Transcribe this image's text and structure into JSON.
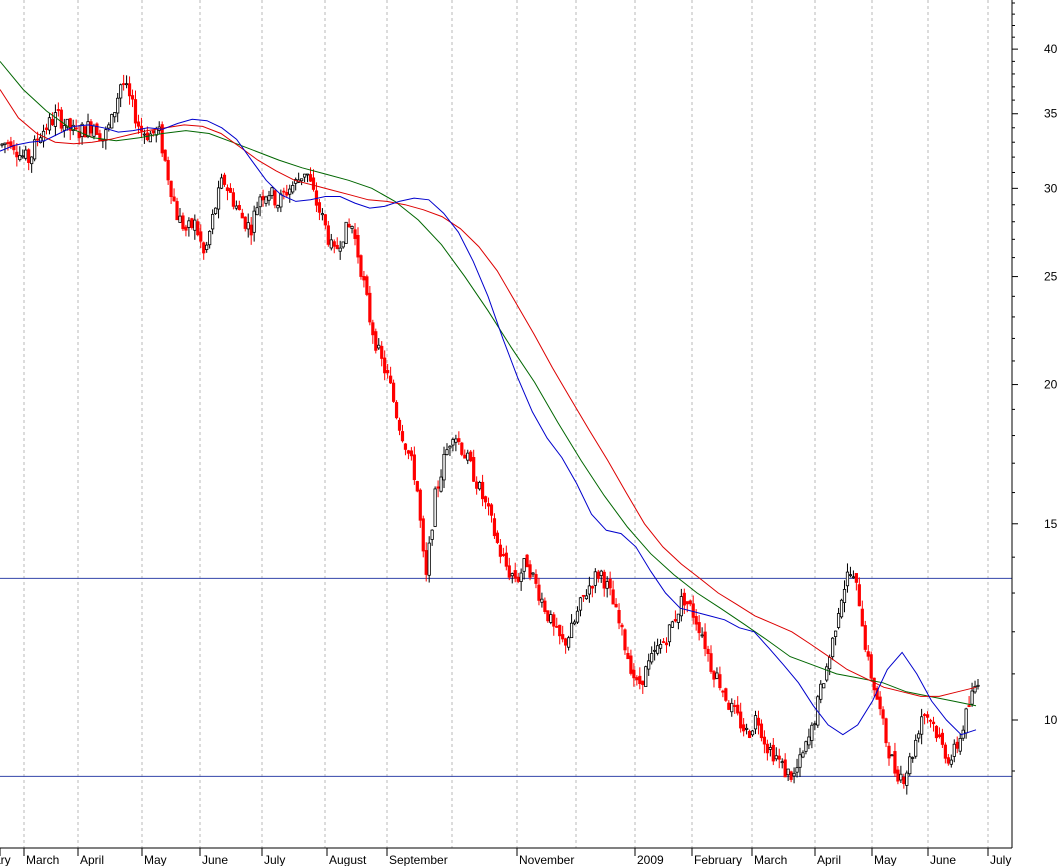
{
  "chart_data": {
    "type": "candlestick",
    "y_scale": "log",
    "ylim": [
      8,
      45
    ],
    "y_ticks": [
      10,
      15,
      20,
      25,
      30,
      35,
      40
    ],
    "y_tick_labels": [
      "10",
      "15",
      "20",
      "25",
      "30",
      "35",
      "40"
    ],
    "x_tick_labels": [
      "ary",
      "March",
      "April",
      "May",
      "June",
      "July",
      "August",
      "September",
      "November",
      "2009",
      "February",
      "March",
      "April",
      "May",
      "June",
      "July"
    ],
    "grid": "vertical dashed",
    "horizontal_lines": [
      13.4,
      8.9
    ],
    "colors": {
      "up_candle": "#000000",
      "down_candle": "#ff0000",
      "fast_ma": "#0000cc",
      "mid_ma": "#dd0000",
      "slow_ma": "#006600",
      "hline": "#3344aa",
      "grid": "#b8b8b8"
    },
    "prices": [
      32.8,
      33.2,
      32.1,
      31.8,
      33.5,
      34.2,
      34.9,
      34.1,
      33.6,
      33.9,
      34.3,
      33.2,
      34.6,
      37.6,
      35.8,
      33.9,
      33.5,
      33.8,
      30.9,
      28.4,
      27.5,
      27.9,
      26.0,
      28.5,
      30.6,
      29.4,
      28.3,
      27.6,
      29.6,
      29.8,
      29.1,
      29.9,
      30.4,
      31.2,
      29.3,
      27.9,
      26.1,
      27.3,
      27.8,
      25.4,
      22.8,
      21.2,
      20.2,
      18.6,
      17.5,
      16.4,
      13.2,
      15.8,
      17.1,
      18.2,
      17.5,
      16.8,
      16.0,
      15.2,
      14.2,
      13.6,
      13.4,
      13.9,
      13.2,
      12.6,
      12.0,
      11.7,
      12.1,
      12.8,
      13.3,
      13.6,
      13.0,
      12.2,
      11.4,
      10.7,
      11.1,
      11.5,
      11.8,
      12.3,
      12.9,
      12.5,
      12.0,
      11.2,
      10.8,
      10.3,
      10.0,
      9.7,
      10.1,
      9.5,
      9.3,
      9.0,
      8.9,
      9.3,
      9.8,
      10.7,
      11.5,
      12.8,
      13.6,
      13.0,
      11.3,
      10.5,
      9.6,
      9.0,
      8.9,
      9.4,
      10.2,
      10.0,
      9.5,
      9.2,
      9.6,
      10.3,
      10.9
    ],
    "ma_fast": [
      32.4,
      32.8,
      33.0,
      33.1,
      33.6,
      34.1,
      34.2,
      34.0,
      33.7,
      33.8,
      34.0,
      33.9,
      34.3,
      34.6,
      34.5,
      34.0,
      33.2,
      31.8,
      30.5,
      29.6,
      29.2,
      29.3,
      29.5,
      29.5,
      29.1,
      28.8,
      28.9,
      29.2,
      29.4,
      29.3,
      28.5,
      27.4,
      25.8,
      24.0,
      22.0,
      20.3,
      18.9,
      17.9,
      17.2,
      16.3,
      15.3,
      14.8,
      14.7,
      14.3,
      13.6,
      13.0,
      12.6,
      12.5,
      12.4,
      12.3,
      12.1,
      12.0,
      11.6,
      11.2,
      10.8,
      10.3,
      9.9,
      9.7,
      9.9,
      10.4,
      11.1,
      11.5,
      11.0,
      10.4,
      10.0,
      9.7,
      9.8
    ],
    "ma_mid": [
      36.8,
      34.7,
      33.6,
      33.0,
      32.9,
      33.0,
      33.2,
      33.5,
      33.8,
      34.0,
      34.2,
      34.1,
      33.6,
      32.7,
      31.8,
      31.1,
      30.5,
      30.2,
      29.9,
      29.6,
      29.3,
      29.2,
      29.0,
      28.7,
      28.3,
      27.6,
      26.6,
      25.3,
      23.7,
      22.2,
      20.7,
      19.4,
      18.2,
      17.1,
      16.0,
      15.0,
      14.3,
      13.8,
      13.4,
      13.0,
      12.7,
      12.4,
      12.2,
      12.0,
      11.7,
      11.4,
      11.1,
      10.9,
      10.7,
      10.6,
      10.5,
      10.5,
      10.6,
      10.7
    ],
    "ma_slow": [
      39.0,
      36.8,
      35.2,
      34.0,
      33.3,
      33.1,
      33.3,
      33.6,
      33.8,
      33.6,
      33.0,
      32.4,
      31.8,
      31.3,
      30.9,
      30.5,
      30.0,
      29.2,
      28.1,
      26.7,
      25.0,
      23.3,
      21.6,
      20.1,
      18.5,
      17.1,
      15.9,
      14.9,
      14.1,
      13.5,
      13.0,
      12.6,
      12.2,
      11.8,
      11.4,
      11.2,
      11.0,
      10.9,
      10.8,
      10.6,
      10.5,
      10.4,
      10.3
    ]
  }
}
